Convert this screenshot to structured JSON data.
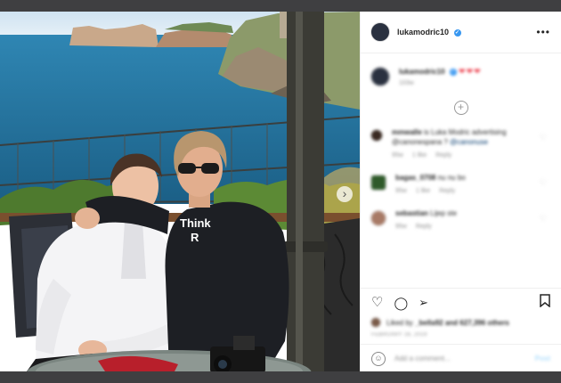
{
  "post": {
    "username": "lukamodric10",
    "more_icon": "ellipsis-icon",
    "photo": {
      "shirt_text_line1": "Think",
      "shirt_text_line2": "R"
    },
    "caption": {
      "username": "lukamodric10",
      "emoji": "❤❤❤",
      "time": "103w"
    },
    "comments": [
      {
        "username": "mmwalle",
        "text": "is Luka Modric advertising @canonespana ?",
        "mention": "@canonuse",
        "age": "95w",
        "likes": "1 like",
        "reply": "Reply"
      },
      {
        "username": "bagas_0708",
        "text": "nu nu bo",
        "age": "95w",
        "likes": "1 like",
        "reply": "Reply"
      },
      {
        "username": "sebastian",
        "text": "Lijep ste",
        "age": "95w",
        "reply": "Reply"
      }
    ],
    "liked_by": {
      "prefix": "Liked by",
      "user": "_bella92",
      "suffix": "and 627,396 others"
    },
    "date": "FEBRUARY 16, 2019",
    "add_comment_placeholder": "Add a comment...",
    "post_label": "Post",
    "colors": {
      "accent": "#3897f0",
      "heart": "#ed4956",
      "background": "#3f3f41"
    }
  }
}
